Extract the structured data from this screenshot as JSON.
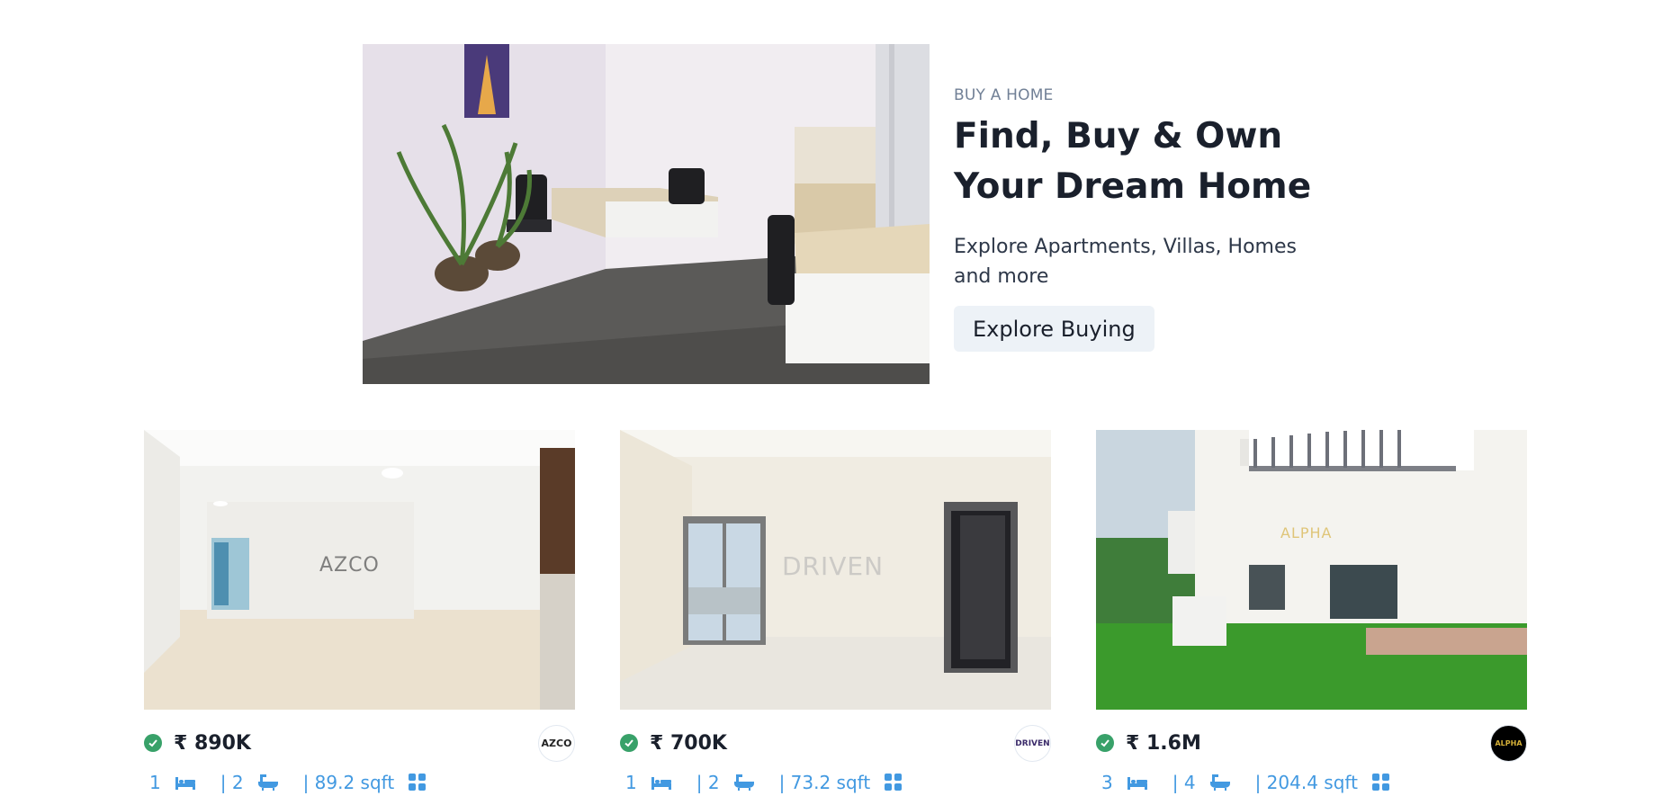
{
  "hero": {
    "eyebrow": "BUY A HOME",
    "title": "Find, Buy & Own Your Dream Home",
    "subtitle": "Explore Apartments, Villas, Homes and more",
    "button_label": "Explore Buying"
  },
  "listings": [
    {
      "price": "₹ 890K",
      "beds": "1",
      "baths": "| 2",
      "area": "| 89.2 sqft",
      "agency_logo_text": "AZCO",
      "watermark": "AZCO"
    },
    {
      "price": "₹ 700K",
      "beds": "1",
      "baths": "| 2",
      "area": "| 73.2 sqft",
      "agency_logo_text": "DRIVEN",
      "watermark": "DRIVEN"
    },
    {
      "price": "₹ 1.6M",
      "beds": "3",
      "baths": "| 4",
      "area": "| 204.4 sqft",
      "agency_logo_text": "ALPHA",
      "watermark": "ALPHA"
    }
  ],
  "colors": {
    "accent_blue": "#4299e1",
    "verified_green": "#38a169",
    "button_bg": "#edf2f7"
  },
  "icons": [
    "verified-check-icon",
    "bed-icon",
    "bath-icon",
    "grid-icon"
  ]
}
